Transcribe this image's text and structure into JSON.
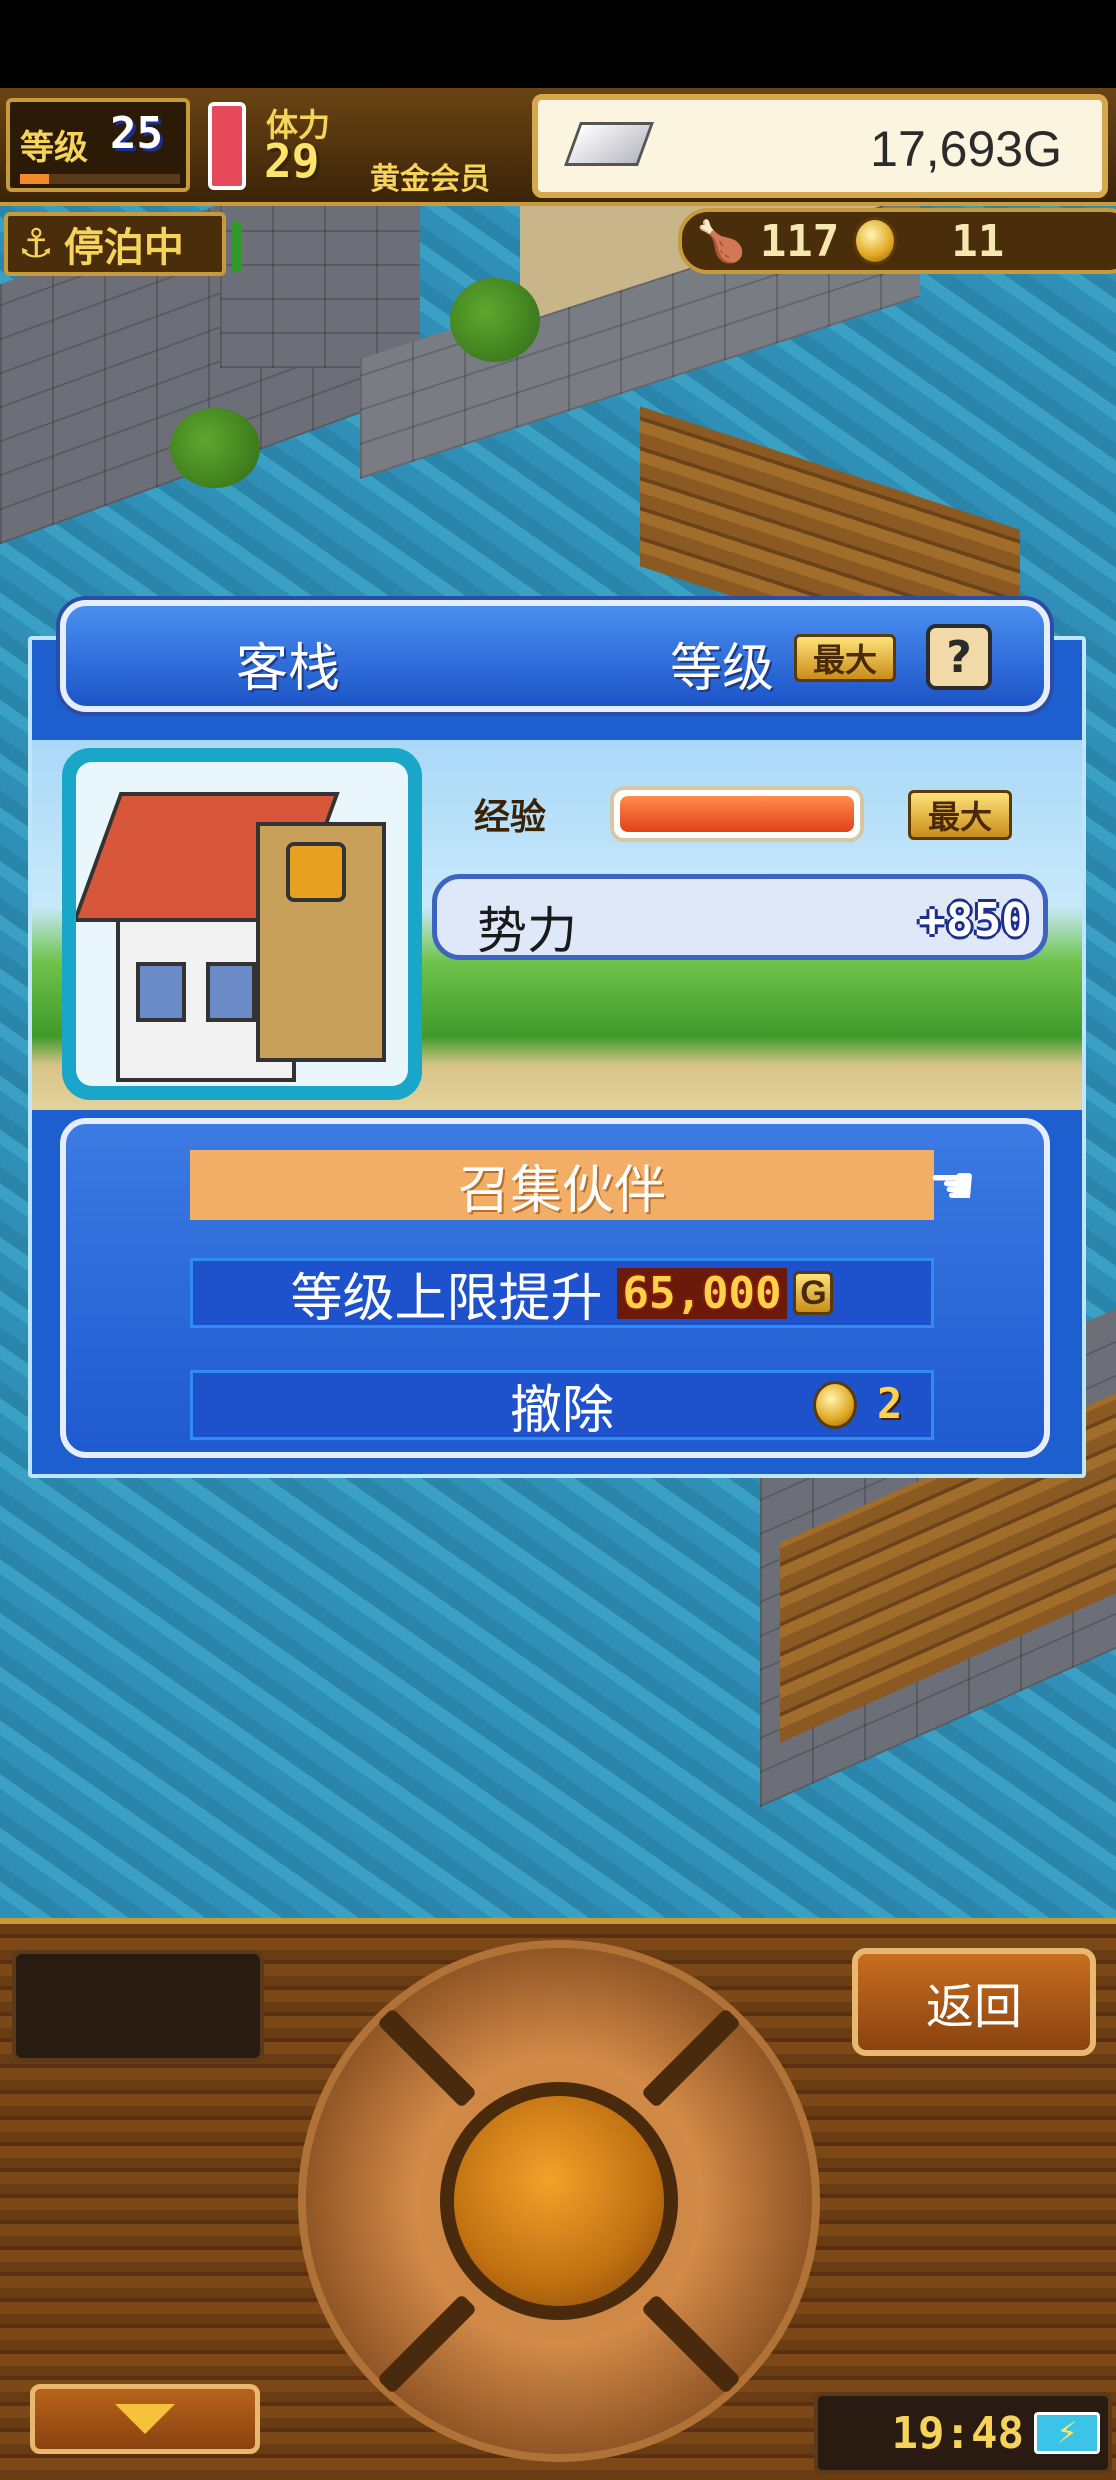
{
  "hud": {
    "level_label": "等级",
    "level": "25",
    "stamina_label": "体力",
    "stamina": "29",
    "membership": "黄金会员",
    "gold": "17,693G",
    "status": "停泊中",
    "resource_1": "117",
    "resource_2": "11"
  },
  "dialog": {
    "title": "客栈",
    "level_label": "等级",
    "level_badge": "最大",
    "help_label": "?",
    "exp_label": "经验",
    "exp_fill": 1.0,
    "exp_badge": "最大",
    "power_label": "势力",
    "power_value": "+850"
  },
  "actions": {
    "recruit_label": "召集伙伴",
    "upgrade_label": "等级上限提升",
    "upgrade_cost": "65,000",
    "upgrade_currency": "G",
    "remove_label": "撤除",
    "remove_cost": "2"
  },
  "console": {
    "back_label": "返回",
    "clock": "19:48"
  },
  "colors": {
    "dialog_blue": "#1e5fd0",
    "recruit_orange": "#f2ad66",
    "gold": "#f6d35a"
  }
}
